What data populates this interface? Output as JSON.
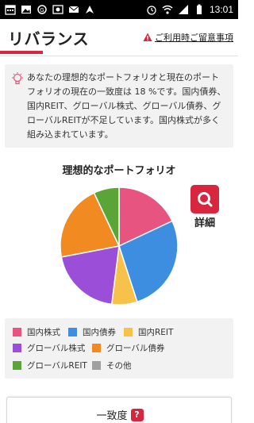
{
  "status_bar": {
    "time": "13:01",
    "left_icons": [
      "calendar-icon",
      "image-icon",
      "sync-icon",
      "photo-icon",
      "mail-icon",
      "nav-icon"
    ],
    "right_icons": [
      "alarm-icon",
      "wifi-icon",
      "signal-icon",
      "battery-icon"
    ]
  },
  "header": {
    "title": "リバランス",
    "notice": "ご利用時ご留意事項",
    "accent_color": "#d7263d"
  },
  "info": {
    "text": "あなたの理想的なポートフォリオと現在のポートフォリオの現在の一致度は 18 %です。国内債券、国内REIT、グローバル株式、グローバル債券、グローバルREITが不足しています。国内株式が多く組み込まれています。"
  },
  "chart_title": "理想的なポートフォリオ",
  "detail_button": {
    "label": "詳細"
  },
  "chart_data": {
    "type": "pie",
    "title": "理想的なポートフォリオ",
    "slices": [
      {
        "name": "国内株式",
        "value": 18,
        "color": "#e75480"
      },
      {
        "name": "国内債券",
        "value": 27,
        "color": "#3d8ee0"
      },
      {
        "name": "国内REIT",
        "value": 7,
        "color": "#f7c24a"
      },
      {
        "name": "グローバル株式",
        "value": 20,
        "color": "#9b4fd8"
      },
      {
        "name": "グローバル債券",
        "value": 21,
        "color": "#f28a22"
      },
      {
        "name": "グローバルREIT",
        "value": 7,
        "color": "#5aa438"
      }
    ]
  },
  "legend": [
    {
      "label": "国内株式",
      "color": "#e75480"
    },
    {
      "label": "国内債券",
      "color": "#3d8ee0"
    },
    {
      "label": "国内REIT",
      "color": "#f7c24a"
    },
    {
      "label": "グローバル株式",
      "color": "#9b4fd8"
    },
    {
      "label": "グローバル債券",
      "color": "#f28a22"
    },
    {
      "label": "グローバルREIT",
      "color": "#5aa438"
    },
    {
      "label": "その他",
      "color": "#a0a0a0"
    }
  ],
  "match": {
    "label": "一致度",
    "help": "?"
  }
}
